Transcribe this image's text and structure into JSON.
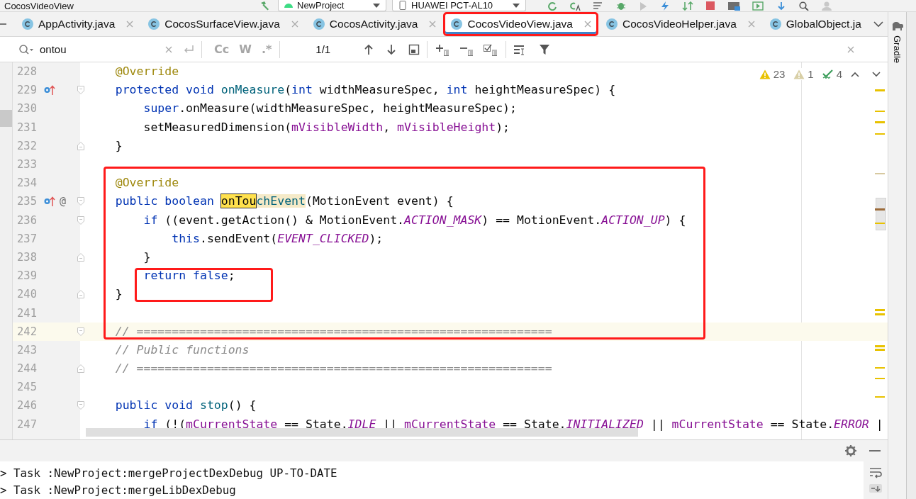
{
  "top_toolbar": {
    "window_title": "CocosVideoView",
    "run_config": "NewProject",
    "device": "HUAWEI PCT-AL10"
  },
  "tabs": [
    {
      "label": "AppActivity.java",
      "selected": false,
      "marked": false
    },
    {
      "label": "CocosSurfaceView.java",
      "selected": false,
      "marked": false
    },
    {
      "label": "CocosActivity.java",
      "selected": false,
      "marked": false
    },
    {
      "label": "CocosVideoView.java",
      "selected": true,
      "marked": true
    },
    {
      "label": "CocosVideoHelper.java",
      "selected": false,
      "marked": false
    },
    {
      "label": "GlobalObject.ja",
      "selected": false,
      "marked": false
    }
  ],
  "search": {
    "value": "ontou",
    "options": [
      {
        "label": "Cc"
      },
      {
        "label": "W"
      },
      {
        "label": ".*"
      }
    ],
    "match_count": "1/1"
  },
  "inspections": {
    "warnings": "23",
    "weak_warnings": "1",
    "typos": "4"
  },
  "lines": [
    {
      "number": "228",
      "current": false,
      "override": false,
      "fold_start": false,
      "fold_end": false,
      "tokens": [
        {
          "kind": "annotation",
          "text": "    @Override"
        }
      ]
    },
    {
      "number": "229",
      "current": false,
      "override": true,
      "fold_start": true,
      "fold_end": false,
      "tokens": [
        {
          "kind": "keyword",
          "text": "    protected "
        },
        {
          "kind": "keyword",
          "text": "void "
        },
        {
          "kind": "method",
          "text": "onMeasure"
        },
        {
          "kind": "plain",
          "text": "("
        },
        {
          "kind": "keyword",
          "text": "int"
        },
        {
          "kind": "plain",
          "text": " widthMeasureSpec, "
        },
        {
          "kind": "keyword",
          "text": "int"
        },
        {
          "kind": "plain",
          "text": " heightMeasureSpec) {"
        }
      ]
    },
    {
      "number": "230",
      "current": false,
      "override": false,
      "fold_start": false,
      "fold_end": false,
      "tokens": [
        {
          "kind": "keyword",
          "text": "        super"
        },
        {
          "kind": "plain",
          "text": ".onMeasure(widthMeasureSpec, heightMeasureSpec);"
        }
      ]
    },
    {
      "number": "231",
      "current": false,
      "override": false,
      "fold_start": false,
      "fold_end": false,
      "tokens": [
        {
          "kind": "plain",
          "text": "        setMeasuredDimension("
        },
        {
          "kind": "field",
          "text": "mVisibleWidth"
        },
        {
          "kind": "plain",
          "text": ", "
        },
        {
          "kind": "field",
          "text": "mVisibleHeight"
        },
        {
          "kind": "plain",
          "text": ");"
        }
      ]
    },
    {
      "number": "232",
      "current": false,
      "override": false,
      "fold_start": false,
      "fold_end": true,
      "tokens": [
        {
          "kind": "plain",
          "text": "    }"
        }
      ]
    },
    {
      "number": "233",
      "current": false,
      "override": false,
      "fold_start": false,
      "fold_end": false
    },
    {
      "number": "234",
      "current": false,
      "override": false,
      "fold_start": false,
      "fold_end": false,
      "tokens": [
        {
          "kind": "annotation",
          "text": "    @Override"
        }
      ]
    },
    {
      "number": "235",
      "current": false,
      "override": true,
      "gutter_text": "@",
      "fold_start": true,
      "fold_end": false,
      "tokens": [
        {
          "kind": "keyword",
          "text": "    public "
        },
        {
          "kind": "keyword",
          "text": "boolean "
        },
        {
          "kind": "match",
          "text": "onTou"
        },
        {
          "kind": "match_rest",
          "text": "chEvent"
        },
        {
          "kind": "plain",
          "text": "(MotionEvent event) {"
        }
      ]
    },
    {
      "number": "236",
      "current": false,
      "override": false,
      "fold_start": true,
      "fold_end": false,
      "tokens": [
        {
          "kind": "keyword",
          "text": "        if"
        },
        {
          "kind": "plain",
          "text": " ((event.getAction() & MotionEvent."
        },
        {
          "kind": "constant",
          "text": "ACTION_MASK"
        },
        {
          "kind": "plain",
          "text": ") == MotionEvent."
        },
        {
          "kind": "constant",
          "text": "ACTION_UP"
        },
        {
          "kind": "plain",
          "text": ") {"
        }
      ]
    },
    {
      "number": "237",
      "current": false,
      "override": false,
      "fold_start": false,
      "fold_end": false,
      "tokens": [
        {
          "kind": "keyword",
          "text": "            this"
        },
        {
          "kind": "plain",
          "text": ".sendEvent("
        },
        {
          "kind": "constant",
          "text": "EVENT_CLICKED"
        },
        {
          "kind": "plain",
          "text": ");"
        }
      ]
    },
    {
      "number": "238",
      "current": false,
      "override": false,
      "fold_start": false,
      "fold_end": true,
      "tokens": [
        {
          "kind": "plain",
          "text": "        }"
        }
      ]
    },
    {
      "number": "239",
      "current": false,
      "override": false,
      "fold_start": false,
      "fold_end": false,
      "tokens": [
        {
          "kind": "keyword",
          "text": "        return "
        },
        {
          "kind": "keyword",
          "text": "false"
        },
        {
          "kind": "plain",
          "text": ";"
        }
      ]
    },
    {
      "number": "240",
      "current": false,
      "override": false,
      "fold_start": false,
      "fold_end": true,
      "tokens": [
        {
          "kind": "plain",
          "text": "    }"
        }
      ]
    },
    {
      "number": "241",
      "current": false,
      "override": false,
      "fold_start": false,
      "fold_end": false
    },
    {
      "number": "242",
      "current": true,
      "override": false,
      "fold_start": true,
      "fold_end": false,
      "tokens": [
        {
          "kind": "comment",
          "text": "    // ==========================================================="
        }
      ]
    },
    {
      "number": "243",
      "current": false,
      "override": false,
      "fold_start": false,
      "fold_end": false,
      "tokens": [
        {
          "kind": "comment",
          "text": "    // Public functions"
        }
      ]
    },
    {
      "number": "244",
      "current": false,
      "override": false,
      "fold_start": false,
      "fold_end": true,
      "tokens": [
        {
          "kind": "comment",
          "text": "    // ==========================================================="
        }
      ]
    },
    {
      "number": "245",
      "current": false,
      "override": false,
      "fold_start": false,
      "fold_end": false
    },
    {
      "number": "246",
      "current": false,
      "override": false,
      "fold_start": true,
      "fold_end": false,
      "tokens": [
        {
          "kind": "keyword",
          "text": "    public "
        },
        {
          "kind": "keyword",
          "text": "void "
        },
        {
          "kind": "method",
          "text": "stop"
        },
        {
          "kind": "plain",
          "text": "() {"
        }
      ]
    },
    {
      "number": "247",
      "current": false,
      "override": false,
      "fold_start": false,
      "fold_end": false,
      "tokens": [
        {
          "kind": "keyword",
          "text": "        if"
        },
        {
          "kind": "plain",
          "text": " (!("
        },
        {
          "kind": "field",
          "text": "mCurrentState"
        },
        {
          "kind": "plain",
          "text": " == State."
        },
        {
          "kind": "constant",
          "text": "IDLE"
        },
        {
          "kind": "plain",
          "text": " || "
        },
        {
          "kind": "field",
          "text": "mCurrentState"
        },
        {
          "kind": "plain",
          "text": " == State."
        },
        {
          "kind": "constant",
          "text": "INITIALIZED"
        },
        {
          "kind": "plain",
          "text": " || "
        },
        {
          "kind": "field",
          "text": "mCurrentState"
        },
        {
          "kind": "plain",
          "text": " == State."
        },
        {
          "kind": "constant",
          "text": "ERROR"
        },
        {
          "kind": "plain",
          "text": " |"
        }
      ]
    }
  ],
  "side_tool": "Gradle",
  "console": {
    "lines": [
      "> Task :NewProject:mergeProjectDexDebug UP-TO-DATE",
      "> Task :NewProject:mergeLibDexDebug"
    ]
  }
}
